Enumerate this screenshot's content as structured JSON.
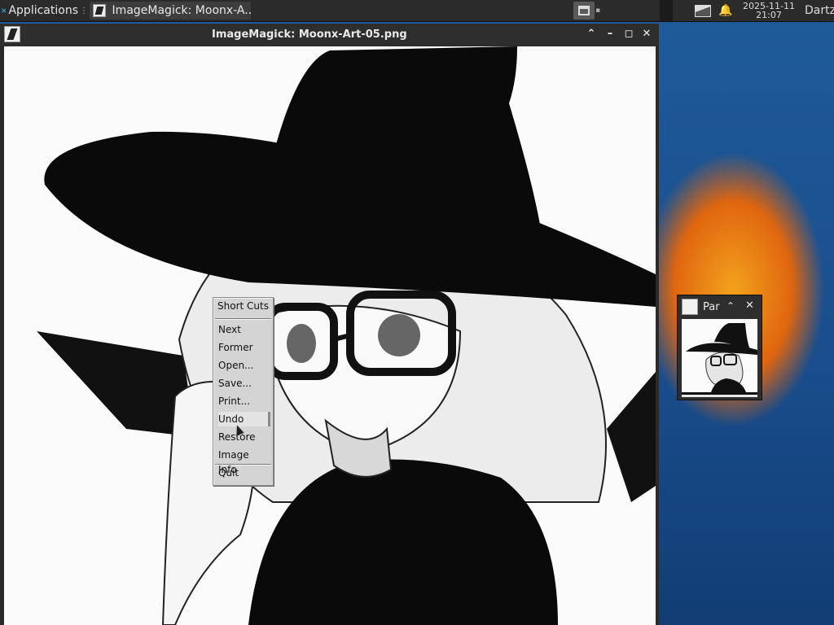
{
  "taskbar": {
    "applications_label": "Applications",
    "task_label": "ImageMagick: Moonx-A...",
    "clock_date": "2025-11-11",
    "clock_time": "21:07",
    "user_name": "Dartz"
  },
  "main_window": {
    "title": "ImageMagick: Moonx-Art-05.png"
  },
  "context_menu": {
    "title": "Short Cuts",
    "items": [
      "Next",
      "Former",
      "Open...",
      "Save...",
      "Print...",
      "Undo",
      "Restore",
      "Image Info",
      "Quit"
    ],
    "highlighted": "Undo"
  },
  "pan_window": {
    "title": "Par"
  },
  "colors": {
    "panel_bg": "#2b2b2b",
    "titlebar_bg": "#2e2e2e",
    "menu_bg": "#d4d4d4",
    "desktop_blue": "#1d4f8a",
    "wallpaper_orange": "#e0660f"
  }
}
